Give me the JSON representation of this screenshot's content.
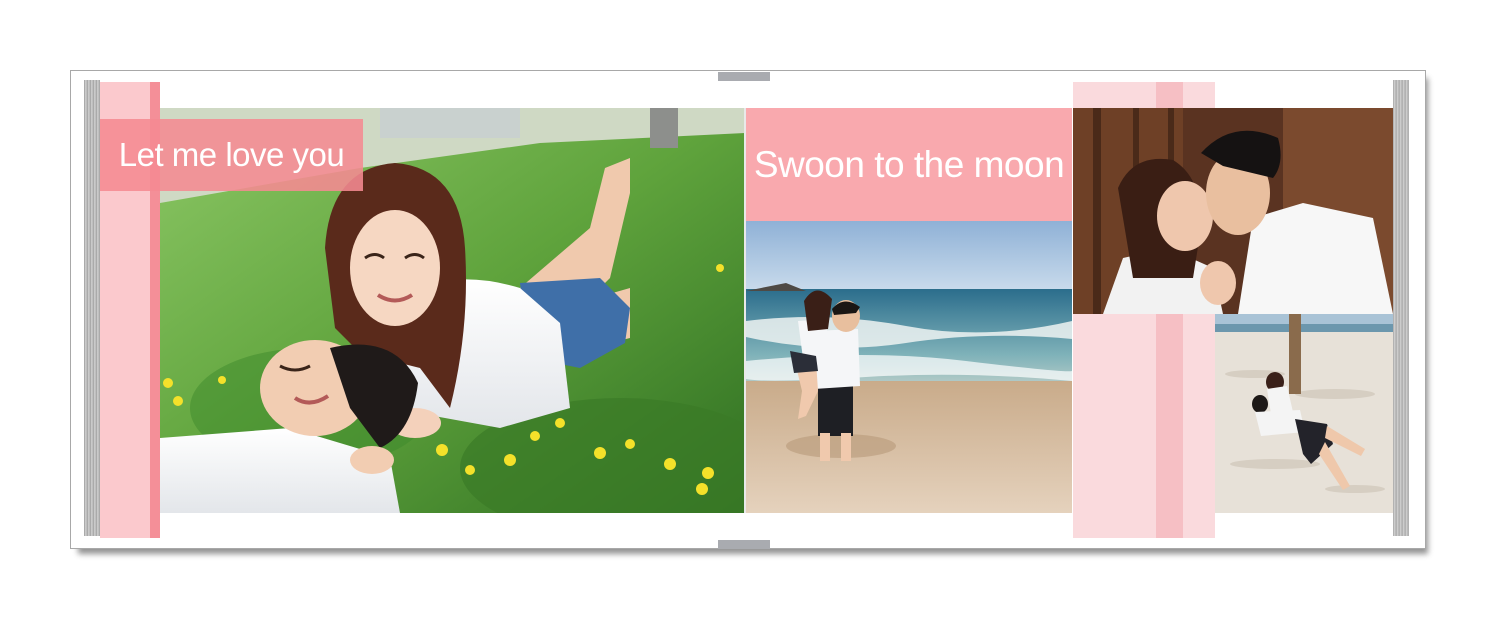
{
  "spread": {
    "left_page": {
      "title": "Let me love you"
    },
    "right_page": {
      "title": "Swoon to the moon"
    }
  },
  "colors": {
    "accent_pink": "#f48f98",
    "light_pink": "#fbc9cd",
    "title_box_pink": "#f9a9ae",
    "spine_gray": "#a9abb0"
  },
  "photos": [
    {
      "name": "couple-lying-on-grass"
    },
    {
      "name": "couple-piggyback-on-beach"
    },
    {
      "name": "couple-close-embrace"
    },
    {
      "name": "couple-sitting-on-sand"
    }
  ]
}
